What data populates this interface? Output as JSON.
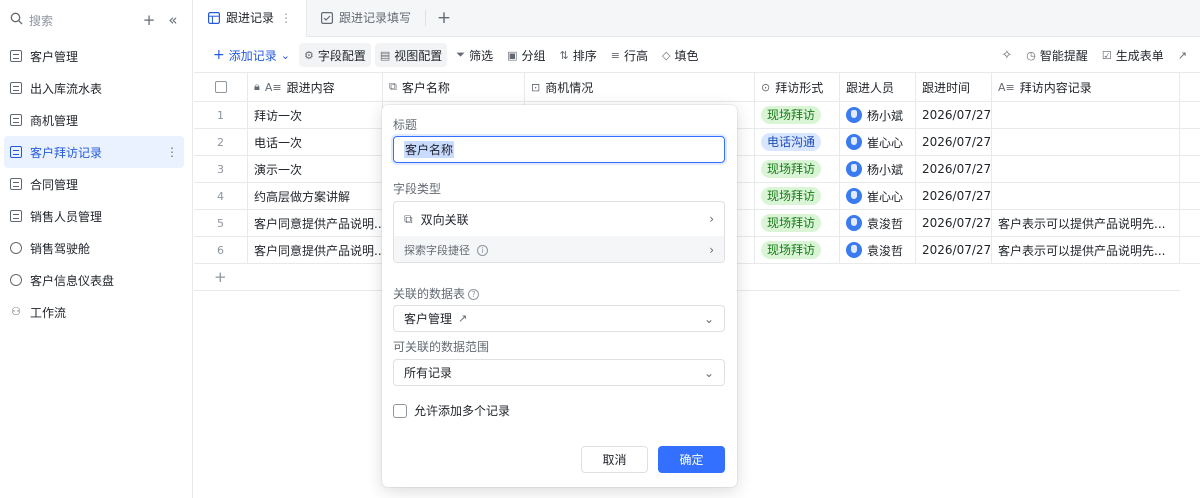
{
  "sidebar": {
    "search_placeholder": "搜索",
    "items": [
      {
        "label": "客户管理",
        "icon": "table-icon"
      },
      {
        "label": "出入库流水表",
        "icon": "table-icon"
      },
      {
        "label": "商机管理",
        "icon": "table-icon"
      },
      {
        "label": "客户拜访记录",
        "icon": "table-icon",
        "active": true
      },
      {
        "label": "合同管理",
        "icon": "table-icon"
      },
      {
        "label": "销售人员管理",
        "icon": "table-icon"
      },
      {
        "label": "销售驾驶舱",
        "icon": "dashboard-icon"
      },
      {
        "label": "客户信息仪表盘",
        "icon": "dashboard-icon"
      },
      {
        "label": "工作流",
        "icon": "workflow-icon"
      }
    ]
  },
  "tabs": [
    {
      "label": "跟进记录",
      "active": true
    },
    {
      "label": "跟进记录填写",
      "active": false
    }
  ],
  "toolbar": {
    "add_record": "添加记录",
    "field_config": "字段配置",
    "view_config": "视图配置",
    "filter": "筛选",
    "group": "分组",
    "sort": "排序",
    "row_height": "行高",
    "fill_color": "填色",
    "smart_remind": "智能提醒",
    "generate_form": "生成表单"
  },
  "table": {
    "columns": [
      "跟进内容",
      "客户名称",
      "商机情况",
      "拜访形式",
      "跟进人员",
      "跟进时间",
      "拜访内容记录"
    ],
    "rows": [
      {
        "num": "1",
        "content": "拜访一次",
        "mode": "现场拜访",
        "person": "杨小斌",
        "date": "2026/07/27",
        "note": ""
      },
      {
        "num": "2",
        "content": "电话一次",
        "mode": "电话沟通",
        "person": "崔心心",
        "date": "2026/07/27",
        "note": ""
      },
      {
        "num": "3",
        "content": "演示一次",
        "mode": "现场拜访",
        "person": "杨小斌",
        "date": "2026/07/27",
        "note": ""
      },
      {
        "num": "4",
        "content": "约高层做方案讲解",
        "mode": "现场拜访",
        "person": "崔心心",
        "date": "2026/07/27",
        "note": ""
      },
      {
        "num": "5",
        "content": "客户同意提供产品说明...",
        "mode": "现场拜访",
        "person": "袁浚哲",
        "date": "2026/07/27",
        "note": "客户表示可以提供产品说明先..."
      },
      {
        "num": "6",
        "content": "客户同意提供产品说明...",
        "mode": "现场拜访",
        "person": "袁浚哲",
        "date": "2026/07/27",
        "note": "客户表示可以提供产品说明先..."
      }
    ],
    "tag_colors": {
      "现场拜访": "#d9f5d6",
      "电话沟通": "#d9e6ff"
    },
    "tag_text_colors": {
      "现场拜访": "#1a7a1a",
      "电话沟通": "#1f4fb5"
    }
  },
  "popup": {
    "title_label": "标题",
    "title_value": "客户名称",
    "field_type_label": "字段类型",
    "field_type_value": "双向关联",
    "explore_path": "探索字段捷径",
    "linked_table_label": "关联的数据表",
    "linked_table_value": "客户管理",
    "scope_label": "可关联的数据范围",
    "scope_value": "所有记录",
    "allow_multiple": "允许添加多个记录",
    "cancel": "取消",
    "confirm": "确定"
  },
  "colors": {
    "accent": "#3370ff",
    "active_bg": "#eaf1ff"
  }
}
